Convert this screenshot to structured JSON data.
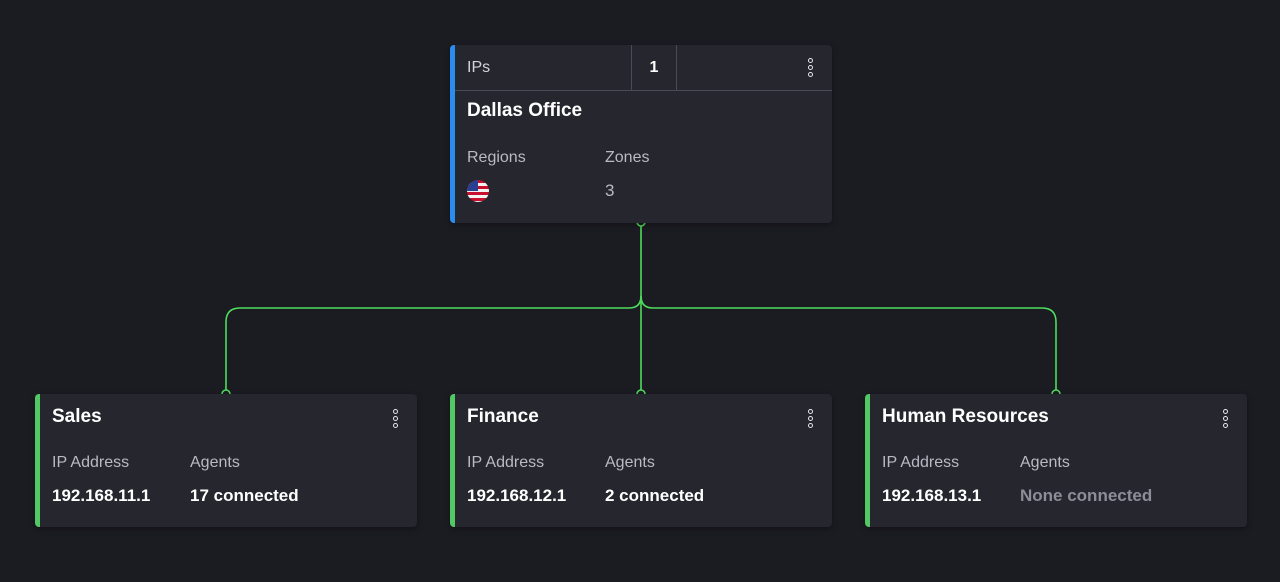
{
  "root": {
    "ips_label": "IPs",
    "ips_count": "1",
    "title": "Dallas Office",
    "regions_label": "Regions",
    "regions_flag": "us-flag-icon",
    "zones_label": "Zones",
    "zones_value": "3",
    "accent": "#2b8cf0"
  },
  "children": [
    {
      "title": "Sales",
      "ip_label": "IP Address",
      "ip_value": "192.168.11.1",
      "agents_label": "Agents",
      "agents_value": "17 connected"
    },
    {
      "title": "Finance",
      "ip_label": "IP Address",
      "ip_value": "192.168.12.1",
      "agents_label": "Agents",
      "agents_value": "2 connected"
    },
    {
      "title": "Human Resources",
      "ip_label": "IP Address",
      "ip_value": "192.168.13.1",
      "agents_label": "Agents",
      "agents_value": "None connected"
    }
  ],
  "colors": {
    "connector": "#4ddc5c",
    "child_accent": "#52c865",
    "background": "#1b1b22",
    "card": "#25262e"
  }
}
